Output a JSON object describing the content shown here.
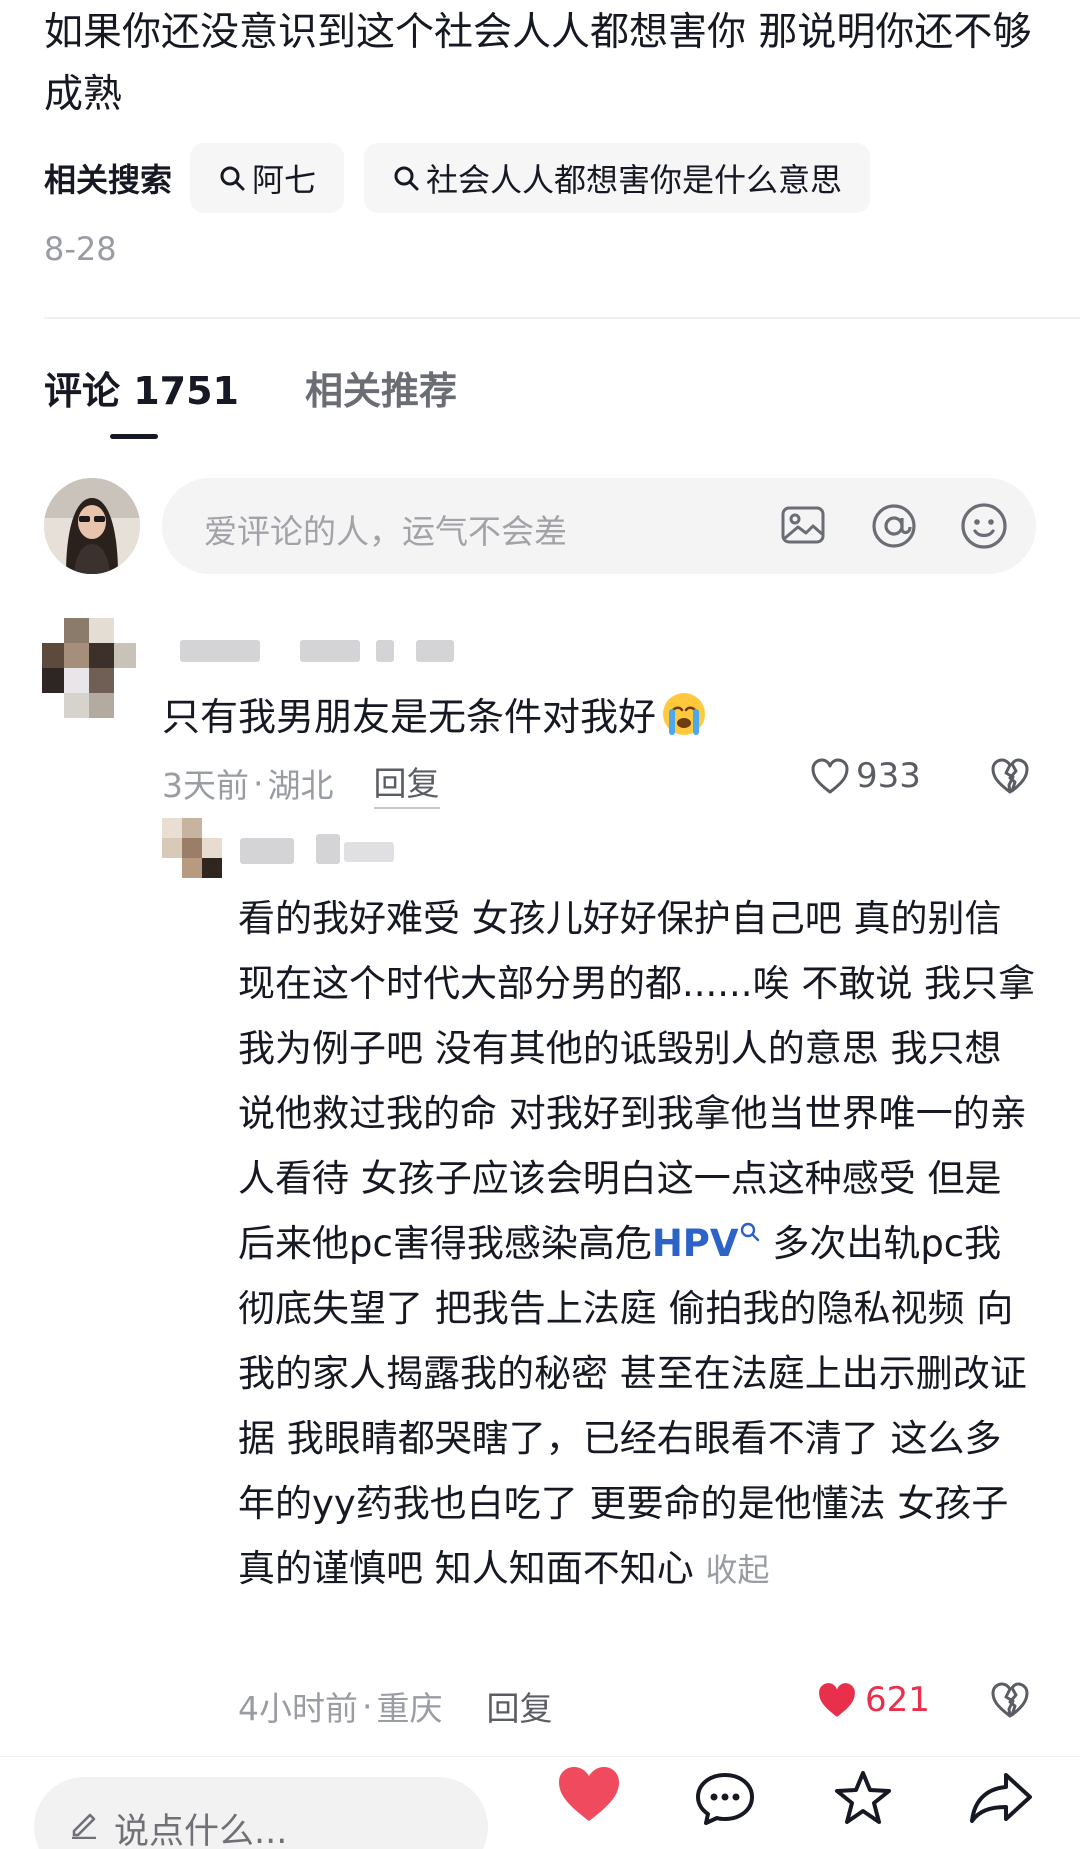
{
  "post": {
    "title": "如果你还没意识到这个社会人人都想害你 那说明你还不够成熟",
    "related_label": "相关搜索",
    "related_searches": [
      "阿七",
      "社会人人都想害你是什么意思"
    ],
    "date": "8-28"
  },
  "tabs": [
    {
      "label": "评论 1751",
      "active": true
    },
    {
      "label": "相关推荐",
      "active": false
    }
  ],
  "comment_input": {
    "placeholder": "爱评论的人，运气不会差",
    "icons": [
      "image-icon",
      "at-icon",
      "emoji-icon"
    ]
  },
  "comments": [
    {
      "text": "只有我男朋友是无条件对我好",
      "emoji": "crying-face",
      "time": "3天前",
      "location": "湖北",
      "reply_label": "回复",
      "likes": "933",
      "liked": false
    },
    {
      "text_before": "看的我好难受 女孩儿好好保护自己吧 真的别信 现在这个时代大部分男的都......唉 不敢说 我只拿我为例子吧 没有其他的诋毁别人的意思 我只想说他救过我的命 对我好到我拿他当世界唯一的亲人看待 女孩子应该会明白这一点这种感受 但是后来他pc害得我感染高危",
      "link_text": "HPV",
      "text_after": " 多次出轨pc我彻底失望了 把我告上法庭 偷拍我的隐私视频 向我的家人揭露我的秘密 甚至在法庭上出示删改证据 我眼睛都哭瞎了，已经右眼看不清了 这么多年的yy药我也白吃了 更要命的是他懂法 女孩子真的谨慎吧 知人知面不知心",
      "collapse_label": "收起",
      "time": "4小时前",
      "location": "重庆",
      "reply_label": "回复",
      "likes": "621",
      "liked": true
    }
  ],
  "bottom_bar": {
    "input_placeholder": "说点什么...",
    "icons": [
      "heart-icon",
      "comment-icon",
      "star-icon",
      "share-icon"
    ]
  },
  "colors": {
    "text": "#161823",
    "muted": "#9a9ca3",
    "link": "#2b63c7",
    "like_red": "#e8304c"
  }
}
